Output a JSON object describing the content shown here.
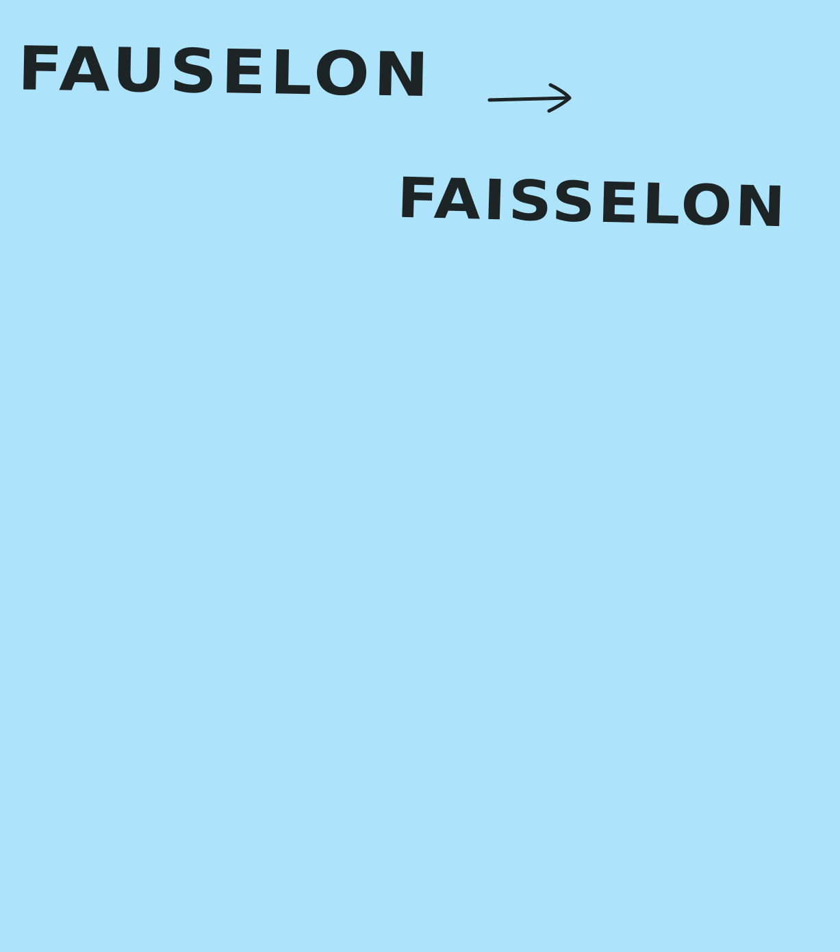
{
  "note": {
    "background_color": "#ade4fb",
    "ink_color": "#1c2426",
    "source_word": "FAUSELON",
    "arrow_icon": "right-arrow-icon",
    "target_word": "FAISSELON"
  }
}
